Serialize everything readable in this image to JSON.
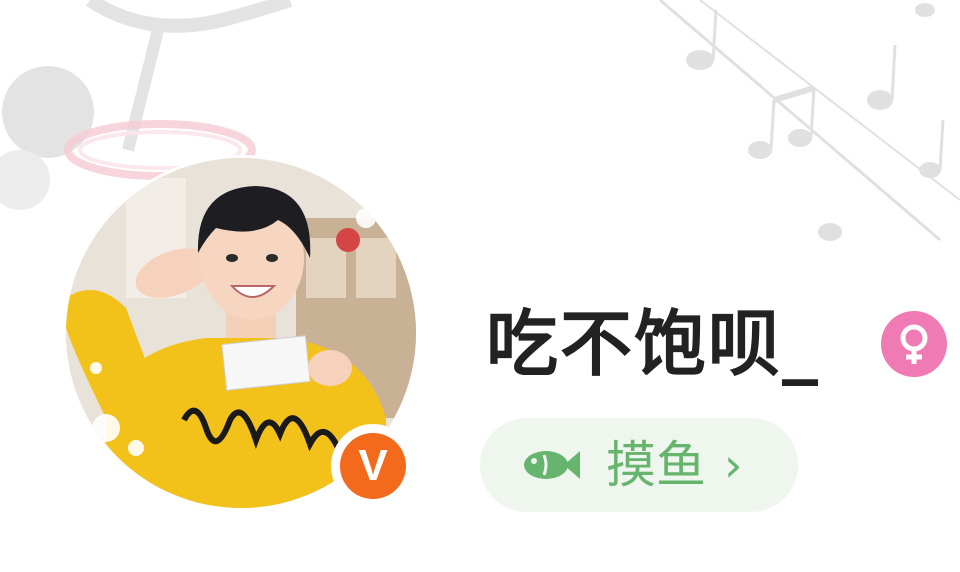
{
  "profile": {
    "username": "吃不饱呗_",
    "gender_icon": "female-icon",
    "vip_badge": "V",
    "status": {
      "label": "摸鱼",
      "icon": "fish-icon",
      "chevron": "›"
    }
  },
  "colors": {
    "gender_badge": "#f07ab3",
    "vip_badge": "#f36a1c",
    "status_chip_bg": "#eef6ee",
    "status_accent": "#67b46f",
    "username": "#222222"
  }
}
